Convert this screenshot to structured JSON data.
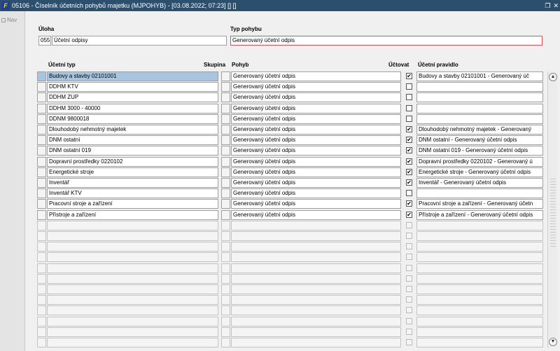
{
  "window": {
    "title": "05106 - Číselník účetních pohybů majetku (MJPOHYB) - [03.08.2022; 07:23]  [] []",
    "icon_text": "F"
  },
  "nav": {
    "label": "Nav"
  },
  "header": {
    "uloha_label": "Úloha",
    "uloha_code": "055",
    "uloha_name": "Účetní odpisy",
    "typ_label": "Typ pohybu",
    "typ_value": "Generovaný účetní odpis"
  },
  "table": {
    "columns": {
      "typ": "Účetní typ",
      "skupina": "Skupina",
      "pohyb": "Pohyb",
      "uctovat": "Účtovat",
      "pravidlo": "Účetní pravidlo"
    },
    "rows": [
      {
        "typ": "Budovy a stavby 02101001",
        "pohyb": "Generovaný účetní odpis",
        "checked": true,
        "pravidlo": "Budovy a stavby 02101001 - Generovaný úč"
      },
      {
        "typ": "DDHM KTV",
        "pohyb": "Generovaný účetní odpis",
        "checked": false,
        "pravidlo": ""
      },
      {
        "typ": "DDHM ZUP",
        "pohyb": "Generovaný účetní odpis",
        "checked": false,
        "pravidlo": ""
      },
      {
        "typ": "DDHM 3000 - 40000",
        "pohyb": "Generovaný účetní odpis",
        "checked": false,
        "pravidlo": ""
      },
      {
        "typ": "DDNM 9800018",
        "pohyb": "Generovaný účetní odpis",
        "checked": false,
        "pravidlo": ""
      },
      {
        "typ": "Dlouhodobý nehmotný majetek",
        "pohyb": "Generovaný účetní odpis",
        "checked": true,
        "pravidlo": "Dlouhodobý nehmotný majetek - Generovaný"
      },
      {
        "typ": "DNM ostatní",
        "pohyb": "Generovaný účetní odpis",
        "checked": true,
        "pravidlo": "DNM ostatní - Generovaný účetní odpis"
      },
      {
        "typ": "DNM ostatní 019",
        "pohyb": "Generovaný účetní odpis",
        "checked": true,
        "pravidlo": "DNM ostatní 019 - Generovaný účetní odpis"
      },
      {
        "typ": "Dopravní prostředky 0220102",
        "pohyb": "Generovaný účetní odpis",
        "checked": true,
        "pravidlo": "Dopravní prostředky 0220102 - Generovaný ú"
      },
      {
        "typ": "Energetické stroje",
        "pohyb": "Generovaný účetní odpis",
        "checked": true,
        "pravidlo": "Energetické stroje - Generovaný účetní odpis"
      },
      {
        "typ": "Inventář",
        "pohyb": "Generovaný účetní odpis",
        "checked": true,
        "pravidlo": "Inventář - Generovaný účetní odpis"
      },
      {
        "typ": "Inventář KTV",
        "pohyb": "Generovaný účetní odpis",
        "checked": false,
        "pravidlo": ""
      },
      {
        "typ": "Pracovní stroje a zařízení",
        "pohyb": "Generovaný účetní odpis",
        "checked": true,
        "pravidlo": "Pracovní stroje a zařízení - Generovaný účetn"
      },
      {
        "typ": "Přístroje a zařízení",
        "pohyb": "Generovaný účetní odpis",
        "checked": true,
        "pravidlo": "Přístroje a zařízení - Generovaný účetní odpis"
      }
    ],
    "empty_rows": 12,
    "check_mark": "✔"
  },
  "scrollbar": {
    "up": "▲",
    "down": "▼"
  },
  "colors": {
    "titlebar": "#2c4f6e",
    "selected_row": "#a8c4e0",
    "highlight_border": "#e05050"
  }
}
